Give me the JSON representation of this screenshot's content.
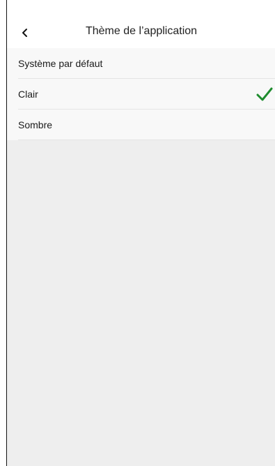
{
  "header": {
    "title": "Thème de l’application",
    "back_icon": "chevron-left-icon"
  },
  "options": [
    {
      "label": "Système par défaut",
      "selected": false
    },
    {
      "label": "Clair",
      "selected": true
    },
    {
      "label": "Sombre",
      "selected": false
    }
  ],
  "colors": {
    "accent_check": "#1e8c2e",
    "background": "#eeeeee",
    "list_background": "#f8f8f8"
  }
}
